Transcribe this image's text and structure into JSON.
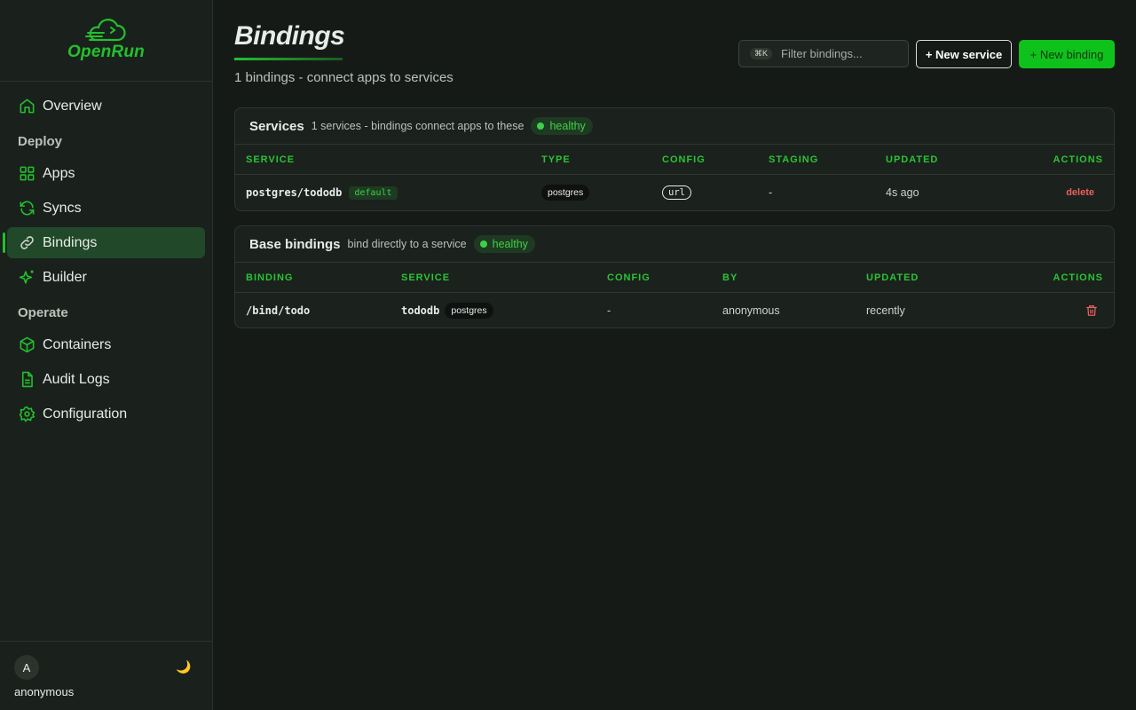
{
  "brand": {
    "name": "OpenRun",
    "accent": "#22c02e"
  },
  "sidebar": {
    "items": [
      {
        "kind": "link",
        "label": "Overview",
        "icon": "home-icon",
        "active": false
      },
      {
        "kind": "section",
        "label": "Deploy"
      },
      {
        "kind": "link",
        "label": "Apps",
        "icon": "grid-icon",
        "active": false
      },
      {
        "kind": "link",
        "label": "Syncs",
        "icon": "refresh-icon",
        "active": false
      },
      {
        "kind": "link",
        "label": "Bindings",
        "icon": "link-icon",
        "active": true
      },
      {
        "kind": "link",
        "label": "Builder",
        "icon": "sparkles-icon",
        "active": false
      },
      {
        "kind": "section",
        "label": "Operate"
      },
      {
        "kind": "link",
        "label": "Containers",
        "icon": "box-icon",
        "active": false
      },
      {
        "kind": "link",
        "label": "Audit Logs",
        "icon": "file-text-icon",
        "active": false
      },
      {
        "kind": "link",
        "label": "Configuration",
        "icon": "gear-icon",
        "active": false
      }
    ],
    "user": {
      "initial": "A",
      "name": "anonymous"
    },
    "theme_icon": "🌙"
  },
  "header": {
    "title": "Bindings",
    "subtitle": "1 bindings - connect apps to services",
    "search": {
      "shortcut": "⌘K",
      "placeholder": "Filter bindings..."
    },
    "new_service_label": "+ New service",
    "new_binding_label": "+ New binding"
  },
  "services": {
    "title": "Services",
    "subtitle": "1 services - bindings connect apps to these",
    "status": "healthy",
    "columns": [
      "SERVICE",
      "TYPE",
      "CONFIG",
      "STAGING",
      "UPDATED",
      "ACTIONS"
    ],
    "rows": [
      {
        "service": "postgres/tododb",
        "tag": "default",
        "type": "postgres",
        "config": "url",
        "staging": "-",
        "updated": "4s ago",
        "action": "delete"
      }
    ]
  },
  "base_bindings": {
    "title": "Base bindings",
    "subtitle": "bind directly to a service",
    "status": "healthy",
    "columns": [
      "BINDING",
      "SERVICE",
      "CONFIG",
      "BY",
      "UPDATED",
      "ACTIONS"
    ],
    "rows": [
      {
        "binding": "/bind/todo",
        "service": "tododb",
        "service_type": "postgres",
        "config": "-",
        "by": "anonymous",
        "updated": "recently",
        "action_icon": "trash-icon"
      }
    ]
  },
  "colors": {
    "danger": "#e8605e",
    "primary_button": "#0fc21b",
    "active_nav": "#22482a"
  }
}
